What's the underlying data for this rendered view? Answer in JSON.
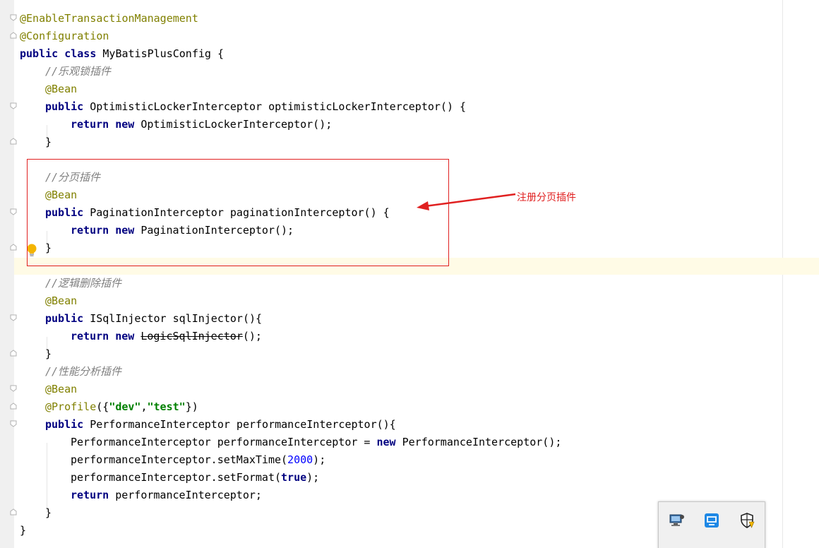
{
  "code": {
    "line1": {
      "annotation": "@EnableTransactionManagement"
    },
    "line2": {
      "annotation": "@Configuration"
    },
    "line3": {
      "kw_public": "public",
      "kw_class": "class",
      "rest": " MyBatisPlusConfig {"
    },
    "line4": {
      "comment": "//乐观锁插件"
    },
    "line5": {
      "annotation": "@Bean"
    },
    "line6": {
      "kw_public": "public",
      "rest": " OptimisticLockerInterceptor optimisticLockerInterceptor() {"
    },
    "line7": {
      "kw_return": "return",
      "kw_new": "new",
      "rest": " OptimisticLockerInterceptor();"
    },
    "line8": {
      "text": "}"
    },
    "line10": {
      "comment": "//分页插件"
    },
    "line11": {
      "annotation": "@Bean"
    },
    "line12": {
      "kw_public": "public",
      "rest": " PaginationInterceptor paginationInterceptor() {"
    },
    "line13": {
      "kw_return": "return",
      "kw_new": "new",
      "rest": " PaginationInterceptor();"
    },
    "line14": {
      "text": "}"
    },
    "line16": {
      "comment": "//逻辑删除插件"
    },
    "line17": {
      "annotation": "@Bean"
    },
    "line18": {
      "kw_public": "public",
      "rest": " ISqlInjector sqlInjector(){"
    },
    "line19": {
      "kw_return": "return",
      "kw_new": "new",
      "deprecated": "LogicSqlInjector",
      "rest": "();"
    },
    "line20": {
      "text": "}"
    },
    "line21": {
      "comment": "//性能分析插件"
    },
    "line22": {
      "annotation": "@Bean"
    },
    "line23": {
      "annotation": "@Profile",
      "open": "({",
      "str1": "\"dev\"",
      "comma": ",",
      "str2": "\"test\"",
      "close": "})"
    },
    "line24": {
      "kw_public": "public",
      "rest": " PerformanceInterceptor performanceInterceptor(){"
    },
    "line25": {
      "pre": "PerformanceInterceptor performanceInterceptor = ",
      "kw_new": "new",
      "rest": " PerformanceInterceptor();"
    },
    "line26": {
      "pre": "performanceInterceptor.setMaxTime(",
      "num": "2000",
      "rest": ");"
    },
    "line27": {
      "pre": "performanceInterceptor.setFormat(",
      "kw_true": "true",
      "rest": ");"
    },
    "line28": {
      "kw_return": "return",
      "rest": " performanceInterceptor;"
    },
    "line29": {
      "text": "}"
    },
    "line30": {
      "text": "}"
    }
  },
  "callout": {
    "label": "注册分页插件",
    "color": "#e02020"
  },
  "colors": {
    "keyword": "#000080",
    "annotation": "#808000",
    "comment": "#808080",
    "string": "#008000",
    "number": "#0000ff",
    "caret_line": "#fffbe6"
  },
  "icons": {
    "intention": "lightbulb-icon",
    "fold": "fold-marker-icon",
    "tray": [
      "remote-desktop-icon",
      "network-app-icon",
      "windows-security-icon"
    ]
  }
}
